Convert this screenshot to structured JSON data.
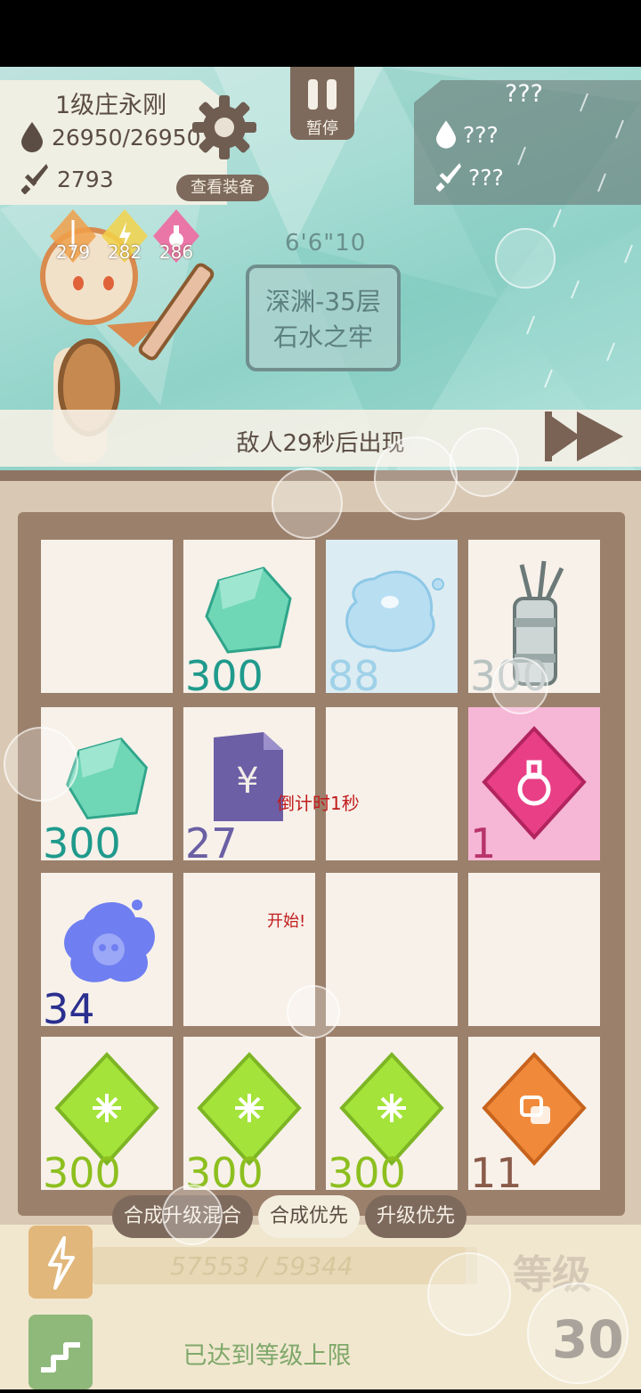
{
  "player": {
    "name": "1级庄永刚",
    "hp": "26950/26950",
    "attack": "2793",
    "equip_button": "查看装备"
  },
  "pause_button": {
    "label": "暂停"
  },
  "enemy": {
    "name": "???",
    "hp": "???",
    "attack": "???"
  },
  "buffs": [
    {
      "value": "279",
      "icon": "arrow-buff-icon",
      "color": "#f0a04a"
    },
    {
      "value": "282",
      "icon": "lightning-buff-icon",
      "color": "#f2d24a"
    },
    {
      "value": "286",
      "icon": "potion-buff-icon",
      "color": "#f06aa2"
    }
  ],
  "timer": "6'6\"10",
  "stage": {
    "line1": "深渊-35层",
    "line2": "石水之牢"
  },
  "wave": {
    "text": "敌人29秒后出现"
  },
  "grid": [
    [
      {
        "item": "",
        "count": ""
      },
      {
        "item": "green-gem-icon",
        "count": "300",
        "count_color": "#1f9a8c"
      },
      {
        "item": "water-bubble-icon",
        "count": "88",
        "count_color": "#9fd1e8"
      },
      {
        "item": "quiver-icon",
        "count": "300",
        "count_color": "#b8c2c0"
      }
    ],
    [
      {
        "item": "green-gem-icon",
        "count": "300",
        "count_color": "#1f9a8c"
      },
      {
        "item": "money-scroll-icon",
        "count": "27",
        "count_color": "#6b5fa4"
      },
      {
        "item": "",
        "count": ""
      },
      {
        "item": "potion-diamond-icon",
        "count": "1",
        "count_color": "#b8346a"
      }
    ],
    [
      {
        "item": "poison-cloud-icon",
        "count": "34",
        "count_color": "#2a2f8f"
      },
      {
        "item": "",
        "count": ""
      },
      {
        "item": "",
        "count": ""
      },
      {
        "item": "",
        "count": ""
      }
    ],
    [
      {
        "item": "lime-diamond-icon",
        "count": "300",
        "count_color": "#8dbf1f"
      },
      {
        "item": "lime-diamond-icon",
        "count": "300",
        "count_color": "#8dbf1f"
      },
      {
        "item": "lime-diamond-icon",
        "count": "300",
        "count_color": "#8dbf1f"
      },
      {
        "item": "orange-diamond-icon",
        "count": "11",
        "count_color": "#8a5a4a"
      }
    ]
  ],
  "floating_texts": {
    "countdown": "倒计时1秒",
    "start": "开始!"
  },
  "tabs": [
    {
      "label": "合成升级混合",
      "active": false
    },
    {
      "label": "合成优先",
      "active": true
    },
    {
      "label": "升级优先",
      "active": false
    }
  ],
  "experience": {
    "text": "57553 / 59344",
    "progress": 0.97
  },
  "level": {
    "label": "等级",
    "value": "30"
  },
  "level_max_text": "已达到等级上限"
}
